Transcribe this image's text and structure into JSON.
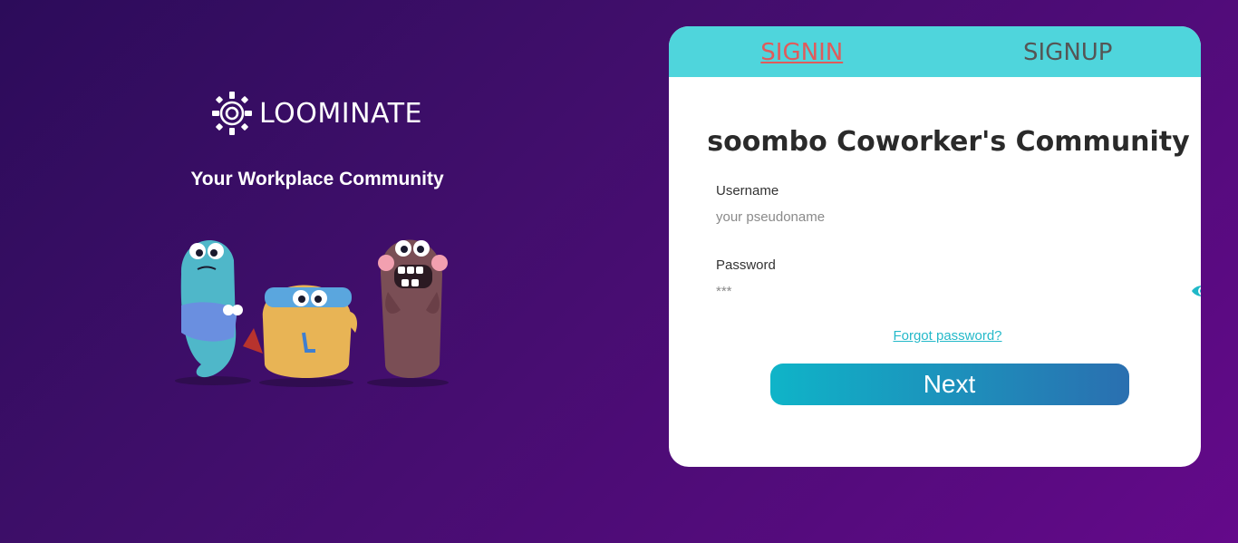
{
  "brand": {
    "logo_text": "LOOMINATE",
    "tagline": "Your Workplace Community",
    "logo_icon": "sun-spiral-icon",
    "mascots_image": "mascot-characters-illustration"
  },
  "tabs": [
    {
      "label": "SIGNIN",
      "active": true
    },
    {
      "label": "SIGNUP",
      "active": false
    }
  ],
  "form": {
    "title": "soombo Coworker's Community",
    "username_label": "Username",
    "username_placeholder": "your pseudoname",
    "password_label": "Password",
    "password_placeholder": "***",
    "show_password_icon": "eye-icon",
    "forgot_link": "Forgot password?",
    "submit_label": "Next"
  },
  "colors": {
    "tab_bar": "#4fd5dc",
    "active_tab": "#e05b5b",
    "link": "#24b9c9",
    "button_start": "#0fb4c8",
    "button_end": "#2a6fb0"
  }
}
